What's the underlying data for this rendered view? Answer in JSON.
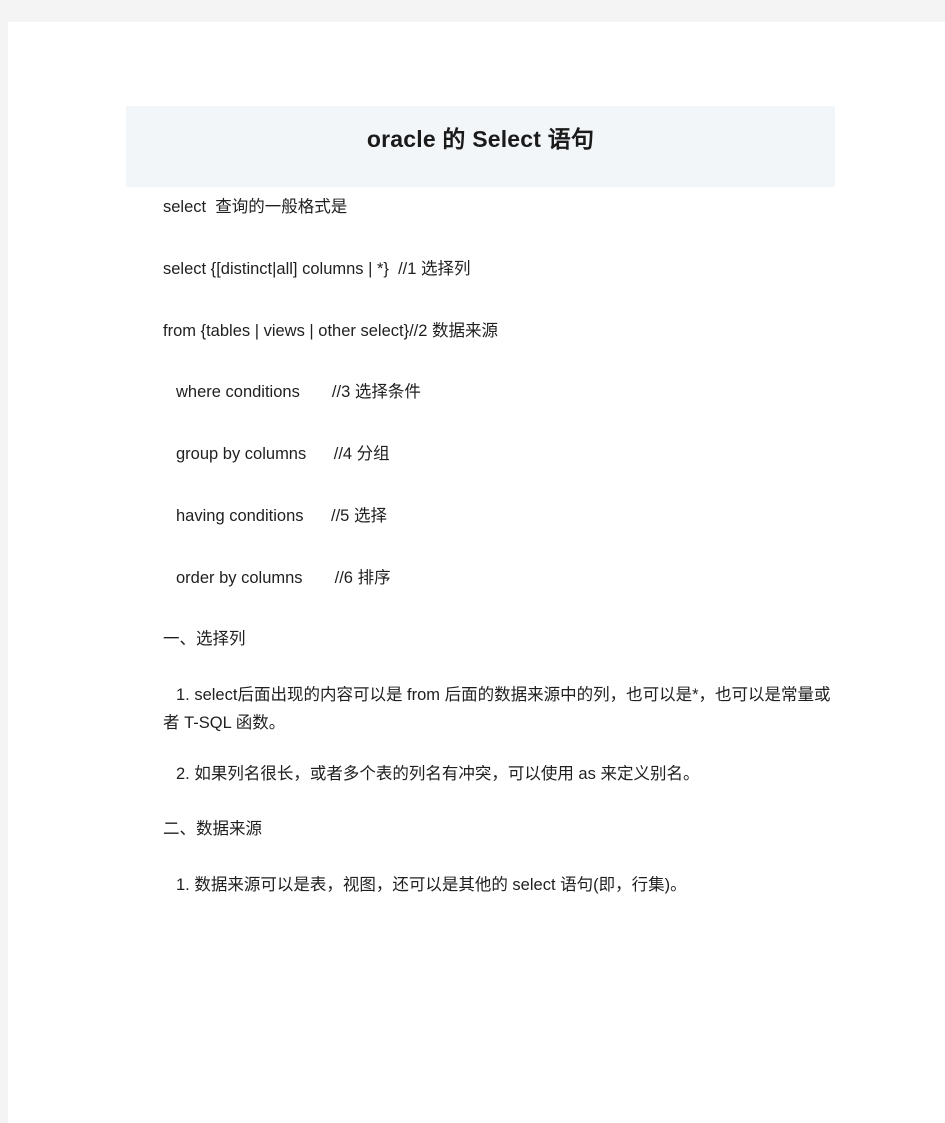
{
  "document": {
    "title": "oracle 的 Select 语句",
    "background_color": "#ffffff",
    "outer_background_color": "#f4f4f4",
    "banner_color": "#f3f6f9",
    "text_color": "#1f1f1f",
    "body": {
      "intro": "select  查询的一般格式是",
      "syntax_lines": [
        "select {[distinct|all] columns | *}  //1 选择列",
        "from {tables | views | other select}//2 数据来源",
        "where conditions       //3 选择条件",
        "group by columns      //4 分组",
        "having conditions      //5 选择",
        "order by columns       //6 排序"
      ],
      "section_one_heading": "一、选择列",
      "section_one_items": [
        "1. select后面出现的内容可以是 from 后面的数据来源中的列，也可以是*，也可以是常量或者 T-SQL 函数。",
        "2. 如果列名很长，或者多个表的列名有冲突，可以使用 as 来定义别名。"
      ],
      "section_two_heading": "二、数据来源",
      "section_two_items": [
        "1. 数据来源可以是表，视图，还可以是其他的 select 语句(即，行集)。"
      ]
    }
  }
}
